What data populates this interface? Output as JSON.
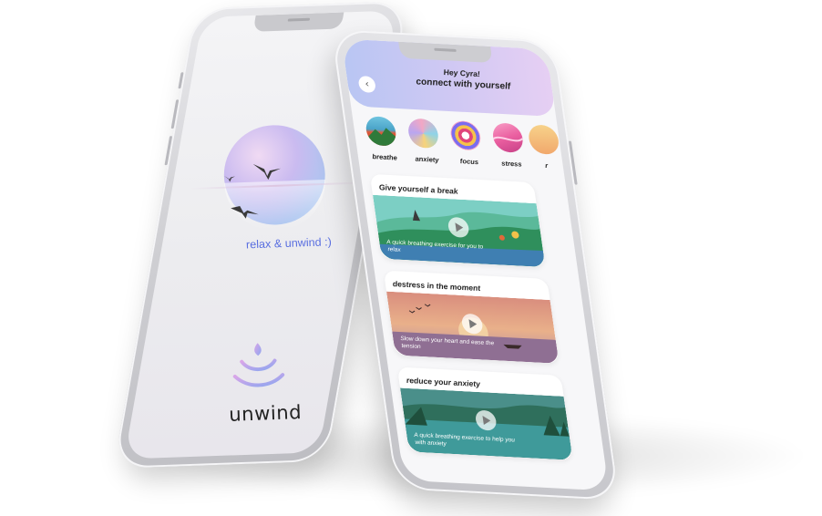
{
  "left_screen": {
    "tagline": "relax & unwind :)",
    "brand": "unwind"
  },
  "right_screen": {
    "greeting": "Hey Cyra!",
    "subtitle": "connect with yourself",
    "moods": [
      {
        "label": "breathe"
      },
      {
        "label": "anxiety"
      },
      {
        "label": "focus"
      },
      {
        "label": "stress"
      },
      {
        "label": "r"
      }
    ],
    "cards": [
      {
        "title": "Give yourself a break",
        "caption": "A quick breathing exercise for you to relax"
      },
      {
        "title": "destress in the moment",
        "caption": "Slow down your heart and ease the tension"
      },
      {
        "title": "reduce your anxiety",
        "caption": "A quick breathing exercise to help you with anxiety"
      }
    ]
  },
  "colors": {
    "accent_text": "#5a6fe0",
    "header_gradient_start": "#b9c6f3",
    "header_gradient_end": "#e6cff3"
  }
}
